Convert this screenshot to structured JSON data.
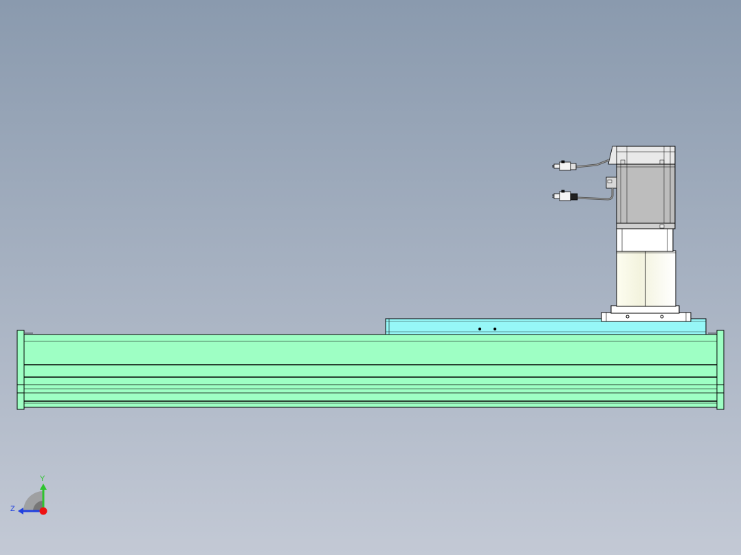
{
  "viewport": {
    "background_top": "#8a9aae",
    "background_bottom": "#c3c9d5"
  },
  "colors": {
    "rail_body": "#9effc4",
    "rail_edge": "#000000",
    "carriage": "#96f7f7",
    "motor_body": "#bdbdbd",
    "motor_cap": "#e9e9e9",
    "coupler_housing": "#f7f7e6",
    "flange": "#ffffff",
    "cable": "#7a7a7a",
    "connector": "#f4f4f4"
  },
  "triad": {
    "y_label": "Y",
    "z_label": "Z",
    "y_color": "#2ec42e",
    "z_color": "#2040e0",
    "origin_color": "#ee1111",
    "arc_color": "#9a9a9a"
  }
}
